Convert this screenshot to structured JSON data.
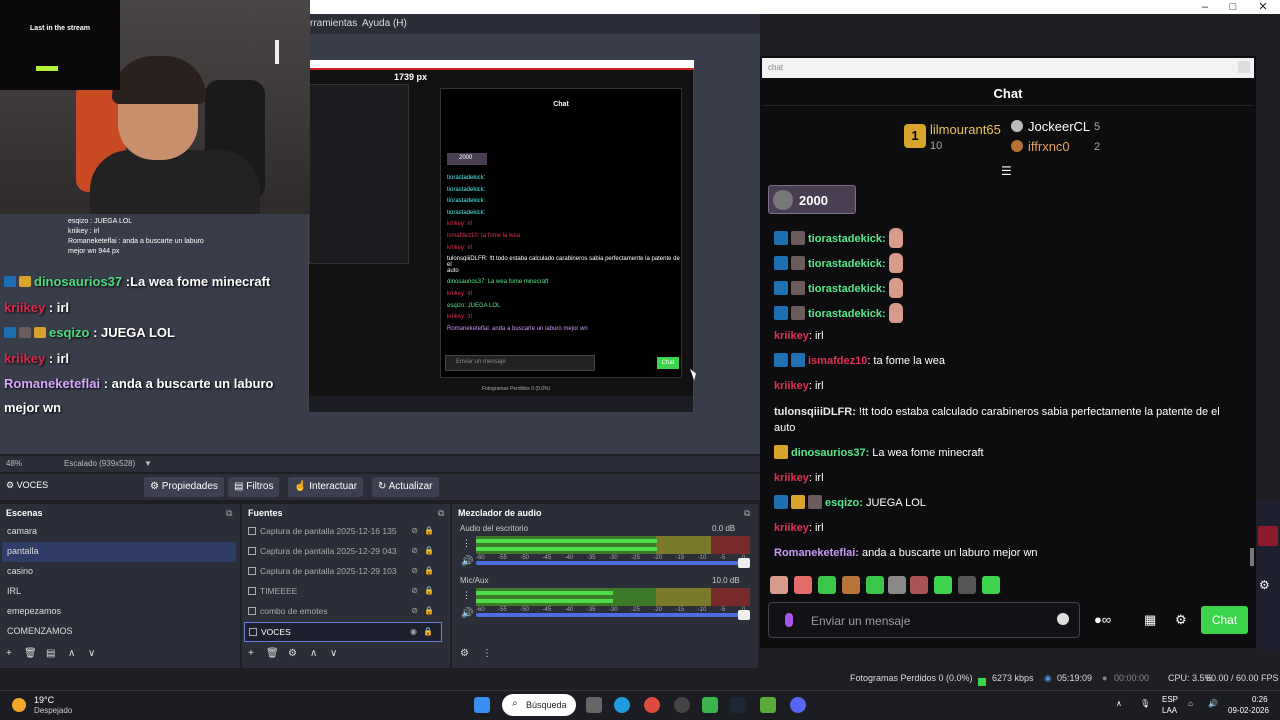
{
  "menu": {
    "tools": "rramientas",
    "help": "Ayuda (H)"
  },
  "stream_overlay": {
    "inset_title": "Last in the stream",
    "small_lines": [
      "esqizo : JUEGA LOL",
      "kriikey : irl",
      "Romaneketeflai : anda a buscarte un laburo",
      "mejor wn  944 px"
    ],
    "lines": [
      {
        "name": "dinosaurios37",
        "text": " :La wea fome minecraft",
        "color": "green"
      },
      {
        "name": "kriikey",
        "text": " : irl",
        "color": "red"
      },
      {
        "name": "esqizo",
        "text": " : JUEGA LOL",
        "color": "green"
      },
      {
        "name": "kriikey",
        "text": " : irl",
        "color": "red"
      },
      {
        "name": "Romaneketeflai",
        "text": " : anda a buscarte un laburo",
        "color": "purple"
      }
    ],
    "line6": "mejor wn"
  },
  "preview": {
    "width_label": "1739 px",
    "inner_chat_title": "Chat",
    "inner_pinned": "2000",
    "inner_input": "Enviar un mensaje",
    "inner_send": "Chat",
    "inner_status": "Fotogramas Perdidos 0 (0.0%)",
    "inner_lines": [
      "tiorastadekick:",
      "tiorastadekick:",
      "tiorastadekick:",
      "tiorastadekick:",
      "kriikey: irl",
      "ismafdez10: ta fome la wea",
      "kriikey: irl",
      "tulonsqiiiDLFR: !tt todo estaba calculado carabineros sabia perfectamente la patente de el",
      "auto",
      "dinosaurios37: La wea fome minecraft",
      "kriikey: irl",
      "esqizo: JUEGA LOL",
      "kriikey: irl",
      "Romaneketeflai: anda a buscarte un laburo mejor wn"
    ]
  },
  "scale": {
    "zoom": "48%",
    "mode": "Escalado (939x528)"
  },
  "toolbar": {
    "source": "VOCES",
    "properties": "Propiedades",
    "filters": "Filtros",
    "interact": "Interactuar",
    "refresh": "Actualizar"
  },
  "scenes": {
    "title": "Escenas",
    "items": [
      "camara",
      "pantalla",
      "casino",
      "IRL",
      "emepezamos",
      "COMENZAMOS"
    ],
    "selected": "pantalla"
  },
  "sources": {
    "title": "Fuentes",
    "items": [
      "Captura de pantalla 2025-12-16 135",
      "Captura de pantalla 2025-12-29 043",
      "Captura de pantalla 2025-12-29 103",
      "TIMEEEE",
      "combo de emotes",
      "VOCES"
    ],
    "selected": "VOCES"
  },
  "mixer": {
    "title": "Mezclador de audio",
    "channels": [
      {
        "name": "Audio del escritorio",
        "db": "0.0 dB",
        "level": 0.66,
        "volume": 1.0
      },
      {
        "name": "Mic/Aux",
        "db": "10.0 dB",
        "level": 0.5,
        "volume": 1.0
      }
    ],
    "ticks": [
      "-60",
      "-55",
      "-50",
      "-45",
      "-40",
      "-35",
      "-30",
      "-25",
      "-20",
      "-15",
      "-10",
      "-5",
      "0"
    ]
  },
  "chat": {
    "window_title": "chat",
    "header": "Chat",
    "leaders": [
      {
        "name": "lilmourant65",
        "score": "10"
      },
      {
        "name": "JockeerCL",
        "score": "5"
      },
      {
        "name": "iffrxnc0",
        "score": "2"
      }
    ],
    "pinned_value": "2000",
    "messages": [
      {
        "name": "tiorastadekick:",
        "text": "",
        "color": "green"
      },
      {
        "name": "tiorastadekick:",
        "text": "",
        "color": "green"
      },
      {
        "name": "tiorastadekick:",
        "text": "",
        "color": "green"
      },
      {
        "name": "tiorastadekick:",
        "text": "",
        "color": "green"
      },
      {
        "name": "kriikey",
        "text": ": irl",
        "color": "red"
      },
      {
        "name": "ismafdez10",
        "text": ": ta fome la wea",
        "color": "red"
      },
      {
        "name": "kriikey",
        "text": ": irl",
        "color": "red"
      },
      {
        "name": "tulonsqiiiDLFR:",
        "text": " !tt todo estaba calculado carabineros sabia perfectamente la patente de el auto",
        "color": "white"
      },
      {
        "name": "dinosaurios37:",
        "text": " La wea fome minecraft",
        "color": "green"
      },
      {
        "name": "kriikey",
        "text": ": irl",
        "color": "red"
      },
      {
        "name": "esqizo:",
        "text": " JUEGA LOL",
        "color": "green"
      },
      {
        "name": "kriikey",
        "text": ": irl",
        "color": "red"
      },
      {
        "name": "Romaneketeflai:",
        "text": " anda a buscarte un laburo mejor wn",
        "color": "purple"
      }
    ],
    "input_placeholder": "Enviar un mensaje",
    "send": "Chat"
  },
  "status": {
    "dropped": "Fotogramas Perdidos 0 (0.0%)",
    "bitrate": "6273 kbps",
    "live_time": "05:19:09",
    "rec_time": "00:00:00",
    "cpu": "CPU: 3.5%",
    "fps": "60.00 / 60.00 FPS"
  },
  "taskbar": {
    "temp": "19°C",
    "weather": "Despejado",
    "search": "Búsqueda",
    "lang1": "ESP",
    "lang2": "LAA",
    "time": "0:26",
    "date": "09-02-2026"
  }
}
